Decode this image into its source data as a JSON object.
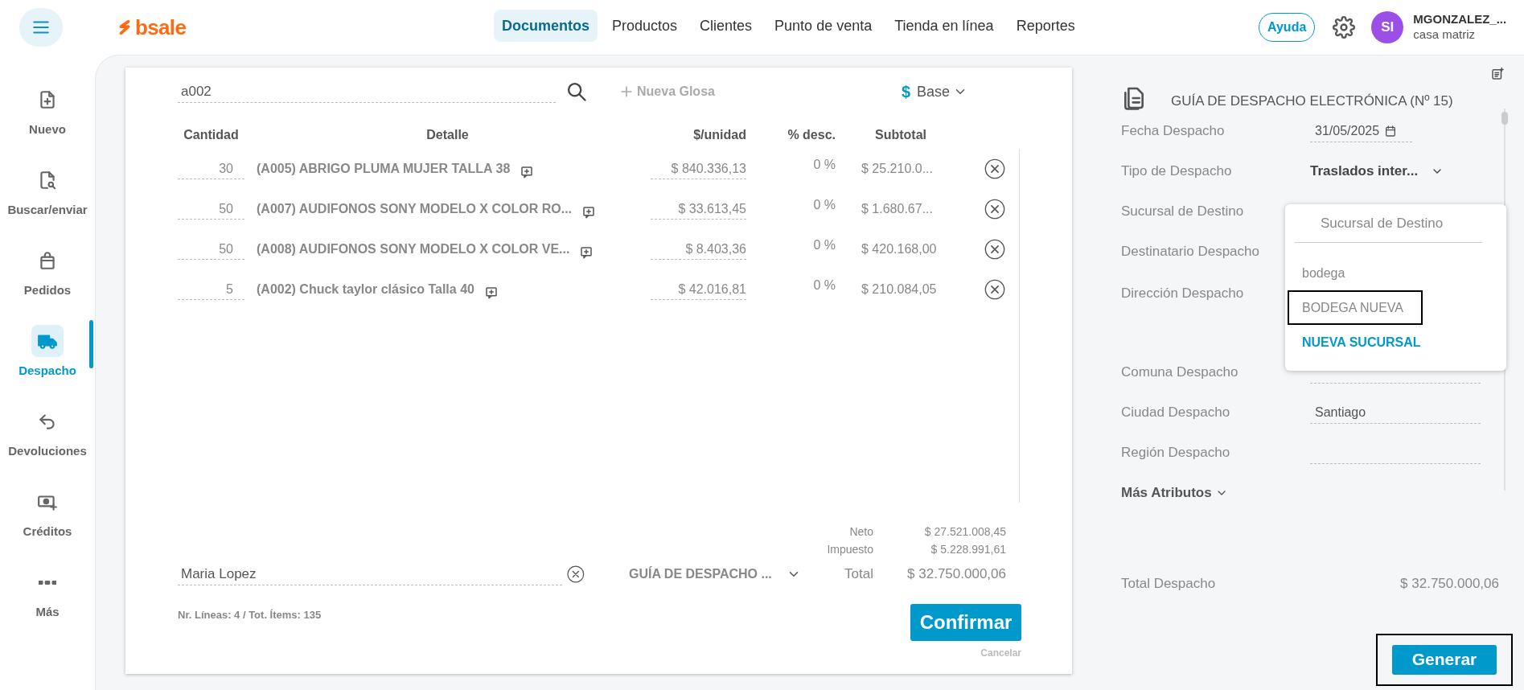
{
  "header": {
    "logo": "bsale",
    "nav": [
      {
        "label": "Documentos",
        "selected": true
      },
      {
        "label": "Productos",
        "selected": false
      },
      {
        "label": "Clientes",
        "selected": false
      },
      {
        "label": "Punto de venta",
        "selected": false
      },
      {
        "label": "Tienda en línea",
        "selected": false
      },
      {
        "label": "Reportes",
        "selected": false
      }
    ],
    "help": "Ayuda",
    "user": {
      "initials": "SI",
      "name": "MGONZALEZ_...",
      "branch": "casa matriz"
    }
  },
  "sidebar": {
    "items": [
      {
        "label": "Nuevo",
        "selected": false
      },
      {
        "label": "Buscar/enviar",
        "selected": false
      },
      {
        "label": "Pedidos",
        "selected": false
      },
      {
        "label": "Despacho",
        "selected": true
      },
      {
        "label": "Devoluciones",
        "selected": false
      },
      {
        "label": "Créditos",
        "selected": false
      },
      {
        "label": "Más",
        "selected": false
      }
    ]
  },
  "document": {
    "search": {
      "value": "a002"
    },
    "new_gloss": "Nueva Glosa",
    "price_list": {
      "symbol": "$",
      "label": "Base"
    },
    "columns": [
      "Cantidad",
      "Detalle",
      "$/unidad",
      "% desc.",
      "Subtotal"
    ],
    "rows": [
      {
        "quantity": "30",
        "detail": "(A005) ABRIGO PLUMA MUJER TALLA 38",
        "unit_price": "$ 840.336,13",
        "discount": "0 %",
        "subtotal": "$ 25.210.0..."
      },
      {
        "quantity": "50",
        "detail": "(A007) AUDIFONOS SONY MODELO X COLOR RO...",
        "unit_price": "$ 33.613,45",
        "discount": "0 %",
        "subtotal": "$ 1.680.67..."
      },
      {
        "quantity": "50",
        "detail": "(A008) AUDIFONOS SONY MODELO X COLOR VE...",
        "unit_price": "$ 8.403,36",
        "discount": "0 %",
        "subtotal": "$ 420.168,00"
      },
      {
        "quantity": "5",
        "detail": "(A002) Chuck taylor clásico Talla 40",
        "unit_price": "$ 42.016,81",
        "discount": "0 %",
        "subtotal": "$ 210.084,05"
      }
    ],
    "summary": [
      {
        "label": "Neto",
        "value": "$ 27.521.008,45"
      },
      {
        "label": "Impuesto",
        "value": "$ 5.228.991,61"
      }
    ],
    "customer": {
      "value": "Maria Lopez"
    },
    "doc_type": "GUÍA DE DESPACHO ...",
    "total": {
      "label": "Total",
      "value": "$ 32.750.000,06"
    },
    "counts": "Nr. Líneas: 4 / Tot. Ítems: 135",
    "confirm": "Confirmar",
    "cancel": "Cancelar"
  },
  "details": {
    "title": "GUÍA DE DESPACHO ELECTRÓNICA (Nº 15)",
    "fields": [
      {
        "label": "Fecha Despacho",
        "kind": "date",
        "value": "31/05/2025"
      },
      {
        "label": "Tipo de Despacho",
        "kind": "select",
        "value": "Traslados inter..."
      },
      {
        "label": "Sucursal de Destino"
      },
      {
        "label": "Destinatario Despacho"
      },
      {
        "label": "Dirección Despacho",
        "kind": "tall"
      },
      {
        "label": "Comuna Despacho",
        "kind": "text"
      },
      {
        "label": "Ciudad Despacho",
        "kind": "text",
        "value": "Santiago"
      },
      {
        "label": "Región Despacho",
        "kind": "text"
      }
    ],
    "more": "Más Atributos",
    "total_label": "Total Despacho",
    "total_value": "$ 32.750.000,06",
    "generate": {
      "label": "Generar",
      "highlighted": true
    }
  },
  "dropdown": {
    "title": "Sucursal de Destino",
    "options": [
      {
        "label": "bodega",
        "kind": "option",
        "highlighted": false
      },
      {
        "label": "BODEGA NUEVA",
        "kind": "option",
        "highlighted": true
      },
      {
        "label": "NUEVA SUCURSAL",
        "kind": "action",
        "highlighted": false
      }
    ]
  }
}
